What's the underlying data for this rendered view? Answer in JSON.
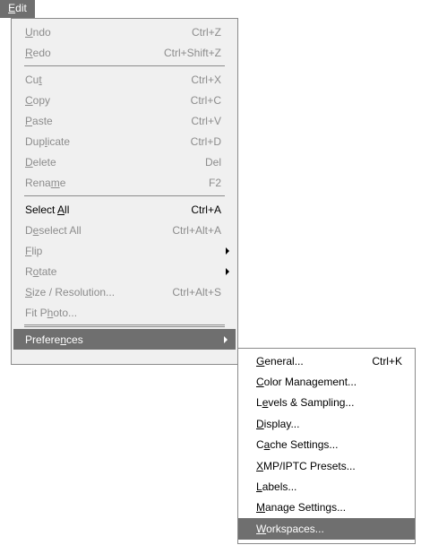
{
  "menubar": {
    "edit": {
      "pre": "",
      "mn": "E",
      "post": "dit"
    }
  },
  "edit_menu": {
    "items": [
      {
        "pre": "",
        "mn": "U",
        "post": "ndo",
        "shortcut": "Ctrl+Z"
      },
      {
        "pre": "",
        "mn": "R",
        "post": "edo",
        "shortcut": "Ctrl+Shift+Z"
      },
      {
        "pre": "Cu",
        "mn": "t",
        "post": "",
        "shortcut": "Ctrl+X"
      },
      {
        "pre": "",
        "mn": "C",
        "post": "opy",
        "shortcut": "Ctrl+C"
      },
      {
        "pre": "",
        "mn": "P",
        "post": "aste",
        "shortcut": "Ctrl+V"
      },
      {
        "pre": "Dup",
        "mn": "l",
        "post": "icate",
        "shortcut": "Ctrl+D"
      },
      {
        "pre": "",
        "mn": "D",
        "post": "elete",
        "shortcut": "Del"
      },
      {
        "pre": "Rena",
        "mn": "m",
        "post": "e",
        "shortcut": "F2"
      },
      {
        "pre": "Select ",
        "mn": "A",
        "post": "ll",
        "shortcut": "Ctrl+A"
      },
      {
        "pre": "D",
        "mn": "e",
        "post": "select All",
        "shortcut": "Ctrl+Alt+A"
      },
      {
        "pre": "",
        "mn": "F",
        "post": "lip",
        "shortcut": ""
      },
      {
        "pre": "R",
        "mn": "o",
        "post": "tate",
        "shortcut": ""
      },
      {
        "pre": "",
        "mn": "S",
        "post": "ize / Resolution...",
        "shortcut": "Ctrl+Alt+S"
      },
      {
        "pre": "Fit P",
        "mn": "h",
        "post": "oto...",
        "shortcut": ""
      },
      {
        "pre": "Prefere",
        "mn": "n",
        "post": "ces",
        "shortcut": ""
      }
    ]
  },
  "preferences_menu": {
    "items": [
      {
        "pre": "",
        "mn": "G",
        "post": "eneral...",
        "shortcut": "Ctrl+K"
      },
      {
        "pre": "",
        "mn": "C",
        "post": "olor Management...",
        "shortcut": ""
      },
      {
        "pre": "L",
        "mn": "e",
        "post": "vels & Sampling...",
        "shortcut": ""
      },
      {
        "pre": "",
        "mn": "D",
        "post": "isplay...",
        "shortcut": ""
      },
      {
        "pre": "C",
        "mn": "a",
        "post": "che Settings...",
        "shortcut": ""
      },
      {
        "pre": "",
        "mn": "X",
        "post": "MP/IPTC Presets...",
        "shortcut": ""
      },
      {
        "pre": "",
        "mn": "L",
        "post": "abels...",
        "shortcut": ""
      },
      {
        "pre": "",
        "mn": "M",
        "post": "anage Settings...",
        "shortcut": ""
      },
      {
        "pre": "",
        "mn": "W",
        "post": "orkspaces...",
        "shortcut": ""
      }
    ]
  },
  "colors": {
    "highlight": "#6f6f6f",
    "menu_bg": "#f0f0f0",
    "disabled_text": "#8c8c8c"
  }
}
